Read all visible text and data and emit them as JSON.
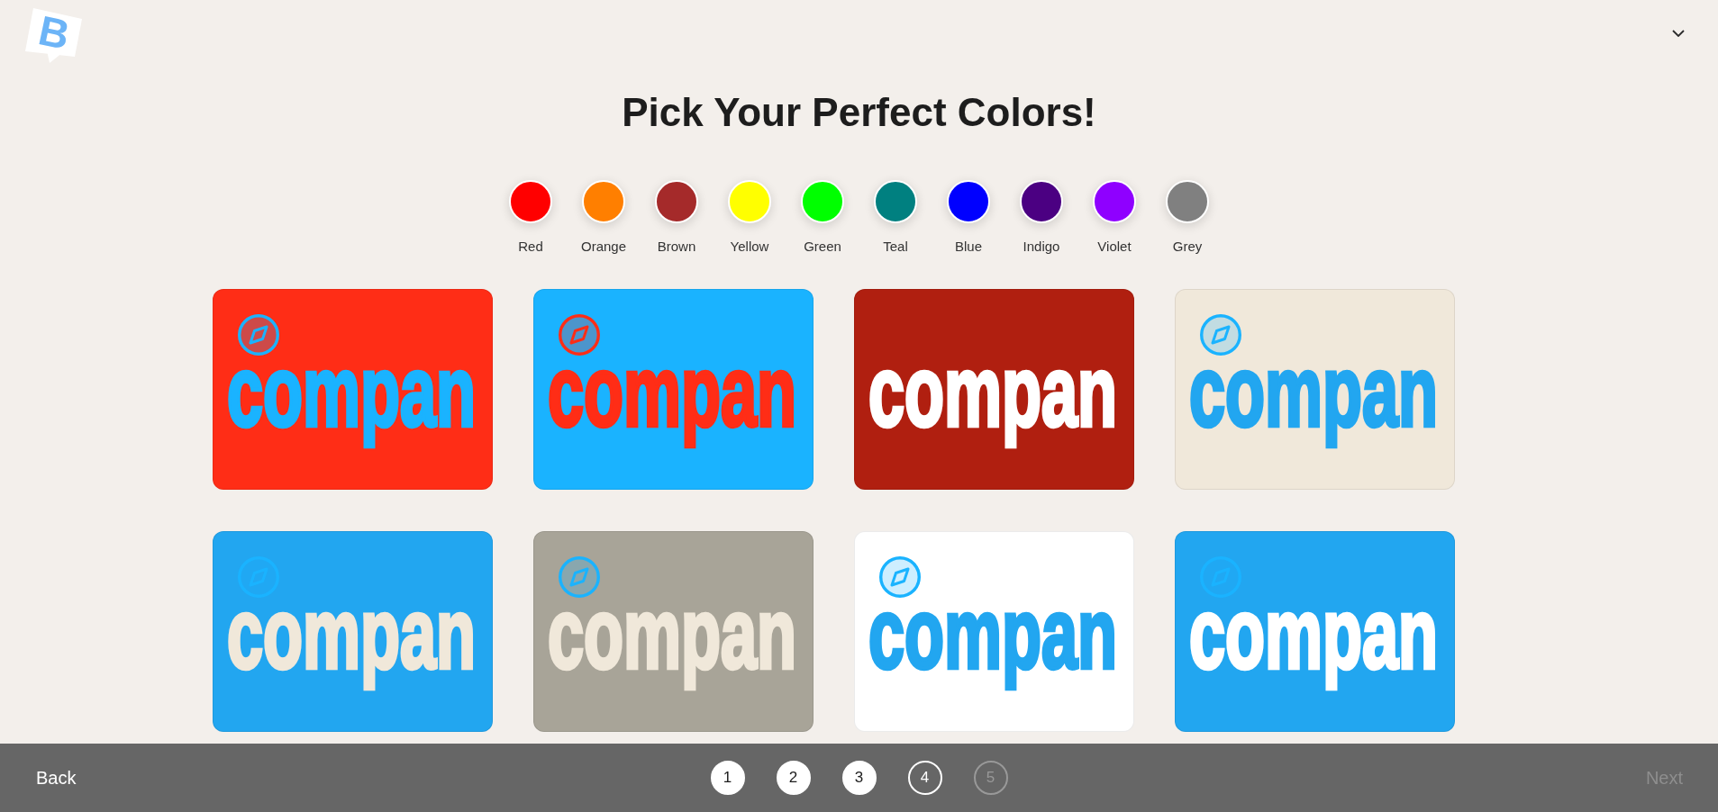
{
  "logo": {
    "letter": "B"
  },
  "title": "Pick Your Perfect Colors!",
  "swatches": [
    {
      "label": "Red",
      "color": "#ff0000",
      "selected": false
    },
    {
      "label": "Orange",
      "color": "#ff7f00",
      "selected": false
    },
    {
      "label": "Brown",
      "color": "#a52a2a",
      "selected": false
    },
    {
      "label": "Yellow",
      "color": "#ffff00",
      "selected": false
    },
    {
      "label": "Green",
      "color": "#00ff00",
      "selected": false
    },
    {
      "label": "Teal",
      "color": "#008080",
      "selected": false
    },
    {
      "label": "Blue",
      "color": "#0000ff",
      "selected": false
    },
    {
      "label": "Indigo",
      "color": "#4b0082",
      "selected": false
    },
    {
      "label": "Violet",
      "color": "#8f00ff",
      "selected": false
    },
    {
      "label": "Grey",
      "color": "#808080",
      "selected": false
    }
  ],
  "cards": [
    {
      "color": "#ff2d16",
      "selected": false,
      "icon": {
        "color": "#1ab3ff"
      },
      "wordmark": {
        "text": "compan",
        "color": "#1ab3ff"
      }
    },
    {
      "color": "#1ab3ff",
      "selected": false,
      "icon": {
        "color": "#ff2d16"
      },
      "wordmark": {
        "text": "compan",
        "color": "#ff2d16"
      }
    },
    {
      "color": "#b01f10",
      "selected": false,
      "wordmark": {
        "text": "compan",
        "color": "#ffffff"
      }
    },
    {
      "color": "#f0e8da",
      "selected": false,
      "icon": {
        "color": "#1ab3ff"
      },
      "wordmark": {
        "text": "compan",
        "color": "#22a6f0"
      }
    },
    {
      "color": "#22a6f0",
      "selected": false,
      "icon": {
        "color": "#1ab3ff"
      },
      "wordmark": {
        "text": "compan",
        "color": "#f0e8da"
      }
    },
    {
      "color": "#a8a498",
      "selected": false,
      "icon": {
        "color": "#1ab3ff"
      },
      "wordmark": {
        "text": "compan",
        "color": "#f0e8da"
      }
    },
    {
      "color": "#ffffff",
      "selected": false,
      "icon": {
        "color": "#1ab3ff"
      },
      "wordmark": {
        "text": "compan",
        "color": "#22a6f0"
      }
    },
    {
      "color": "#22a6f0",
      "selected": false,
      "icon": {
        "color": "#1ab3ff"
      },
      "wordmark": {
        "text": "compan",
        "color": "#ffffff"
      }
    }
  ],
  "footer": {
    "back": "Back",
    "steps": [
      {
        "label": "1",
        "completed": true,
        "current": false
      },
      {
        "label": "2",
        "completed": true,
        "current": false
      },
      {
        "label": "3",
        "completed": true,
        "current": false
      },
      {
        "label": "4",
        "completed": false,
        "current": true
      },
      {
        "label": "5",
        "completed": false,
        "current": false
      }
    ],
    "next": {
      "label": "Next",
      "disabled": true
    }
  }
}
